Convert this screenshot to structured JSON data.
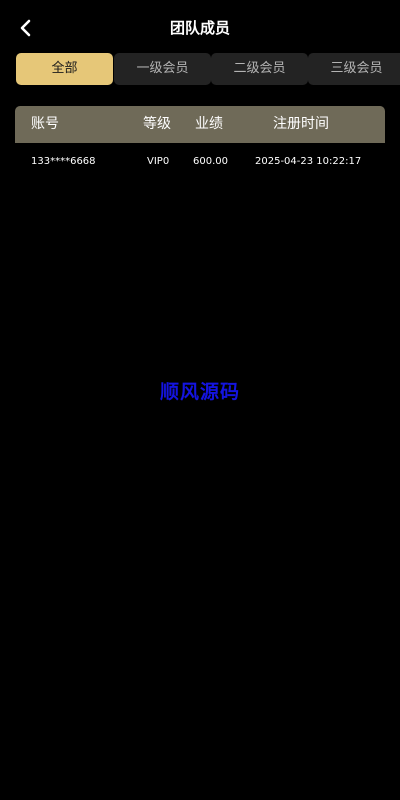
{
  "header": {
    "title": "团队成员",
    "back_icon": "chevron-left-icon"
  },
  "tabs": [
    {
      "label": "全部",
      "active": true
    },
    {
      "label": "一级会员",
      "active": false
    },
    {
      "label": "二级会员",
      "active": false
    },
    {
      "label": "三级会员",
      "active": false
    }
  ],
  "table": {
    "columns": [
      "账号",
      "等级",
      "业绩",
      "注册时间"
    ],
    "rows": [
      [
        "133****6668",
        "VIP0",
        "600.00",
        "2025-04-23 10:22:17"
      ]
    ]
  },
  "watermark": "顺风源码",
  "colors": {
    "background": "#000000",
    "tab_active": "#e6c778",
    "tab_inactive": "#232323",
    "table_header": "#6f6a58",
    "watermark": "#1414e0"
  }
}
